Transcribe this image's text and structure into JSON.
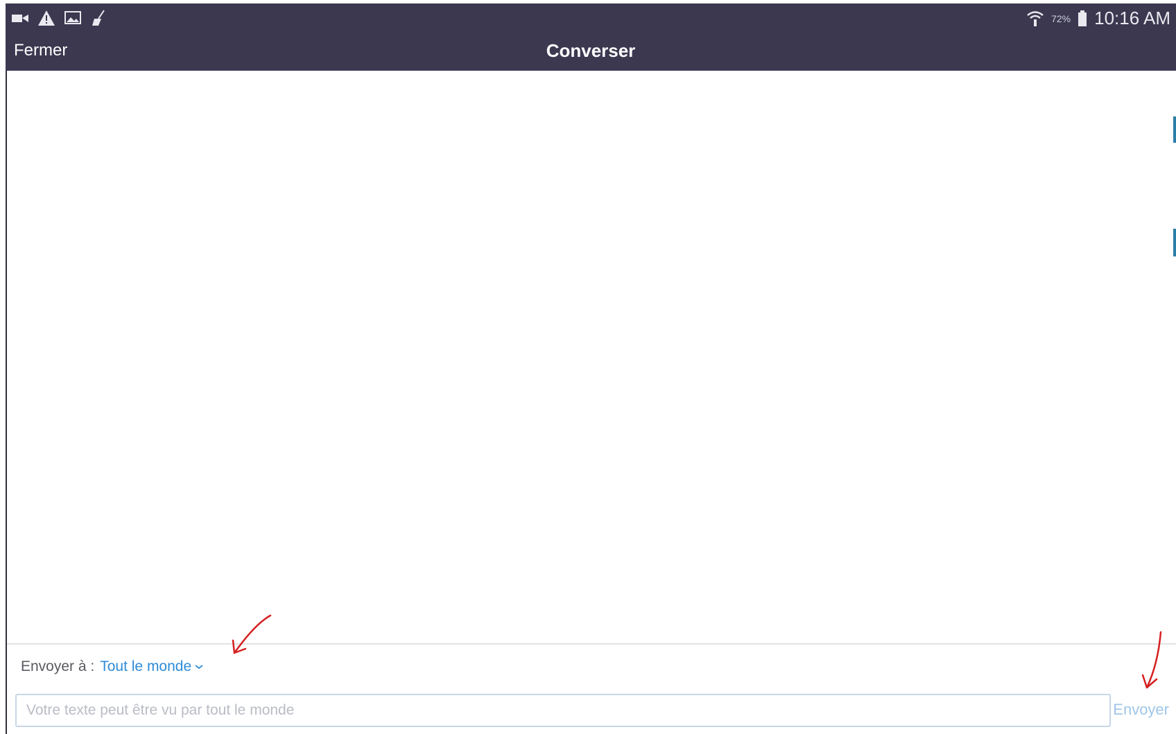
{
  "status_bar": {
    "left_icons": [
      "video-camera-icon",
      "warning-icon",
      "image-icon",
      "broom-icon"
    ],
    "right_icons": [
      "wifi-icon",
      "battery-icon"
    ],
    "battery_percent": "72%",
    "time": "10:16 AM"
  },
  "header": {
    "close_label": "Fermer",
    "title": "Converser"
  },
  "composer": {
    "send_to_label": "Envoyer à :",
    "recipient": "Tout le monde",
    "input_placeholder": "Votre texte peut être vu par tout le monde",
    "send_label": "Envoyer"
  },
  "colors": {
    "header_bg": "#3b3850",
    "recipient_link": "#2e8bd8",
    "send_disabled": "#9fc6e8",
    "annotation_arrow": "#d42020"
  }
}
